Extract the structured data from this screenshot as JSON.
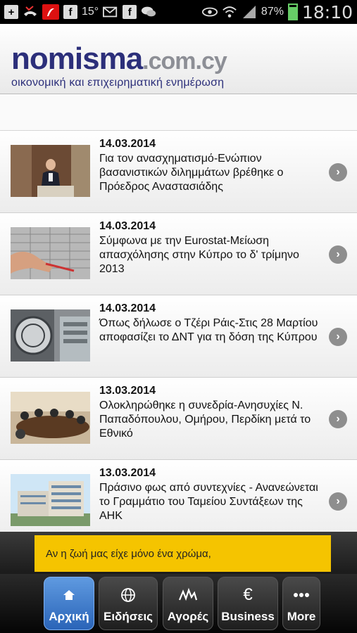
{
  "status_bar": {
    "icons": [
      "add-icon",
      "missed-call-icon",
      "app-icon",
      "facebook-icon",
      "email-icon",
      "facebook-icon",
      "chat-icon",
      "eye-icon",
      "wifi-icon",
      "signal-icon"
    ],
    "temperature": "15°",
    "battery_percent": "87%",
    "battery_level": 0.87,
    "time": "18:10"
  },
  "header": {
    "logo_main": "nomisma",
    "logo_domain": ".com.cy",
    "logo_tagline": "οικονομική και επιχειρηματική ενημέρωση"
  },
  "articles": [
    {
      "date": "14.03.2014",
      "title": "Για τον ανασχηματισμό-Ενώπιον βασανιστικών διλημμάτων βρέθηκε ο Πρόεδρος Αναστασιάδης"
    },
    {
      "date": "14.03.2014",
      "title": "Σύμφωνα με την Eurostat-Μείωση απασχόλησης στην Κύπρο το δ' τρίμηνο 2013"
    },
    {
      "date": "14.03.2014",
      "title": "Όπως δήλωσε ο Τζέρι Ράις-Στις 28 Μαρτίου αποφασίζει το ΔΝΤ για τη δόση της Κύπρου"
    },
    {
      "date": "13.03.2014",
      "title": "Ολοκληρώθηκε η συνεδρία-Ανησυχίες Ν. Παπαδόπουλου, Ομήρου, Περδίκη μετά το Εθνικό"
    },
    {
      "date": "13.03.2014",
      "title": "Πράσινο φως από συντεχνίες - Ανανεώνεται το Γραμμάτιο του Ταμείου Συντάξεων της ΑΗΚ"
    }
  ],
  "ad": {
    "text": "Αν η ζωή μας είχε μόνο ένα χρώμα,"
  },
  "nav": {
    "tabs": [
      {
        "label": "Αρχική",
        "icon": "home-icon"
      },
      {
        "label": "Ειδήσεις",
        "icon": "globe-icon"
      },
      {
        "label": "Αγορές",
        "icon": "chart-icon"
      },
      {
        "label": "Business",
        "icon": "euro-icon"
      },
      {
        "label": "More",
        "icon": "more-icon"
      }
    ]
  },
  "colors": {
    "brand": "#2c2f7a",
    "active_tab": "#3f7fd0",
    "ad": "#f5c400"
  }
}
